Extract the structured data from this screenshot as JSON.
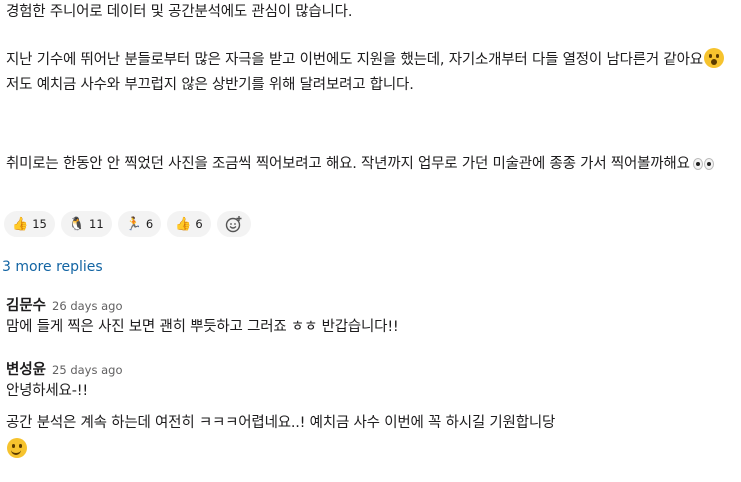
{
  "message": {
    "line1": "경험한 주니어로 데이터 및 공간분석에도 관심이 많습니다.",
    "para2_a": "지난 기수에 뛰어난 분들로부터 많은 자극을 받고 이번에도 지원을 했는데, 자기소개부터 다들 열정이 남다른거 같아요",
    "para2_b": " 저도 예치금 사수와 부끄럽지 않은 상반기를 위해 달려보려고 합니다.",
    "para3": " 취미로는 한동안 안 찍었던 사진을 조금씩 찍어보려고 해요. 작년까지 업무로 가던 미술관에 종종 가서 찍어볼까해요"
  },
  "reactions": [
    {
      "icon": "thumbs-up-icon",
      "glyph": "👍",
      "count": "15"
    },
    {
      "icon": "penguin-icon",
      "glyph": "🐧",
      "count": "11"
    },
    {
      "icon": "running-icon",
      "glyph": "🏃",
      "count": "6"
    },
    {
      "icon": "thumbs-up-yellow-icon",
      "glyph": "👍",
      "count": "6"
    }
  ],
  "thread": {
    "more_replies": "3 more replies",
    "replies": [
      {
        "name": "김문수",
        "time": "26 days ago",
        "text": "맘에 들게 찍은 사진 보면 괜히 뿌듯하고 그러죠 ㅎㅎ 반갑습니다!!"
      },
      {
        "name": "변성윤",
        "time": "25 days ago",
        "text": "안녕하세요-!!",
        "text2": "공간 분석은 계속 하는데 여전히 ㅋㅋㅋ어렵네요..! 예치금 사수 이번에 꼭 하시길 기원합니당"
      }
    ]
  },
  "colors": {
    "link": "#1264a3",
    "reaction_bg": "#f3f3f3",
    "emoji": "#f6c32e"
  }
}
